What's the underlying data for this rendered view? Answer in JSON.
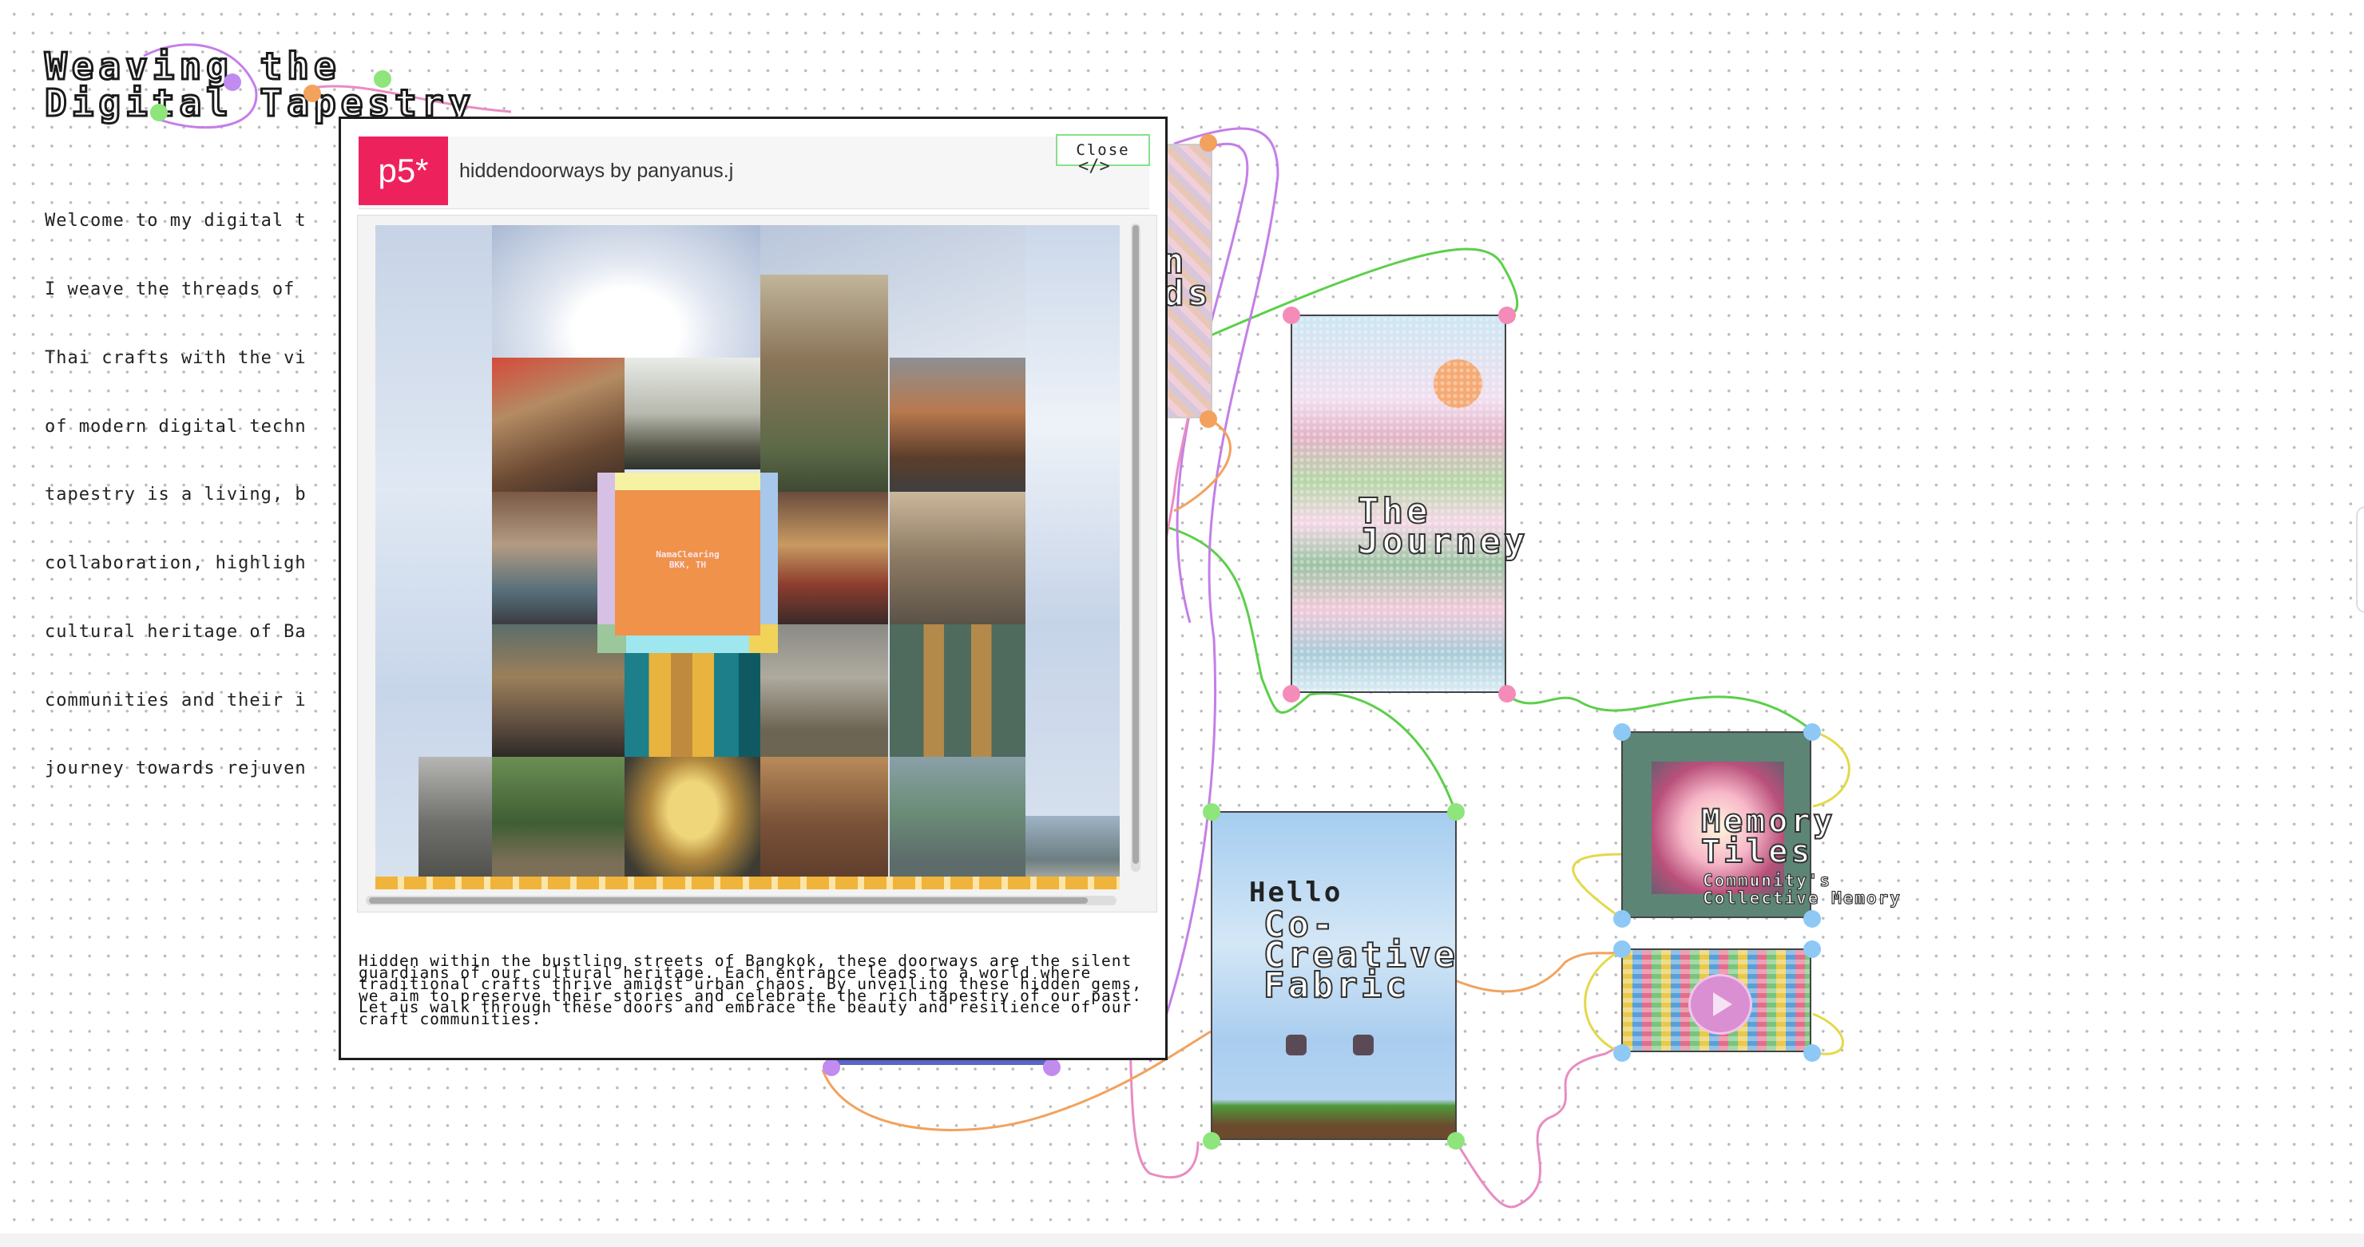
{
  "page": {
    "title_lines": [
      "Weaving the",
      "Digital Tapestry"
    ],
    "intro_lines": [
      "Welcome to my digital t",
      "I weave the threads of",
      "Thai crafts with the vi",
      "of modern digital techn",
      "tapestry is a living, b",
      "collaboration, highligh",
      "cultural heritage of Ba",
      "communities and their i",
      "journey towards rejuven"
    ]
  },
  "modal": {
    "logo": "p5*",
    "sketch_title": "hiddendoorways by panyanus.j",
    "close_label": "Close",
    "code_icon": "</>",
    "center_tile_text": [
      "NamaClearing",
      "BKK, TH"
    ],
    "description": "Hidden within the bustling streets of Bangkok, these doorways are the silent guardians of our cultural heritage. Each entrance leads to a world where traditional crafts thrive amidst urban chaos. By unveiling these hidden gems, we aim to preserve their stories and celebrate the rich tapestry of our past. Let us walk through these doors and embrace the beauty and resilience of our craft communities."
  },
  "cards": {
    "partial_label": [
      "n",
      "ds"
    ],
    "journey_label": [
      "The",
      "Journey"
    ],
    "fabric_label": [
      "Co-",
      "Creative",
      "Fabric"
    ],
    "fabric_inner": "Hello",
    "memory_label": [
      "Memory",
      "Tiles"
    ],
    "memory_sub": [
      "Community's",
      "Collective Memory"
    ],
    "video_icon": "play-button"
  },
  "colors": {
    "wire_green": "#5ccf4a",
    "wire_purple": "#c57ee8",
    "wire_pink": "#e98cc2",
    "wire_orange": "#f2a25d",
    "wire_yellow": "#e3d94a",
    "p5_red": "#ed225d"
  }
}
